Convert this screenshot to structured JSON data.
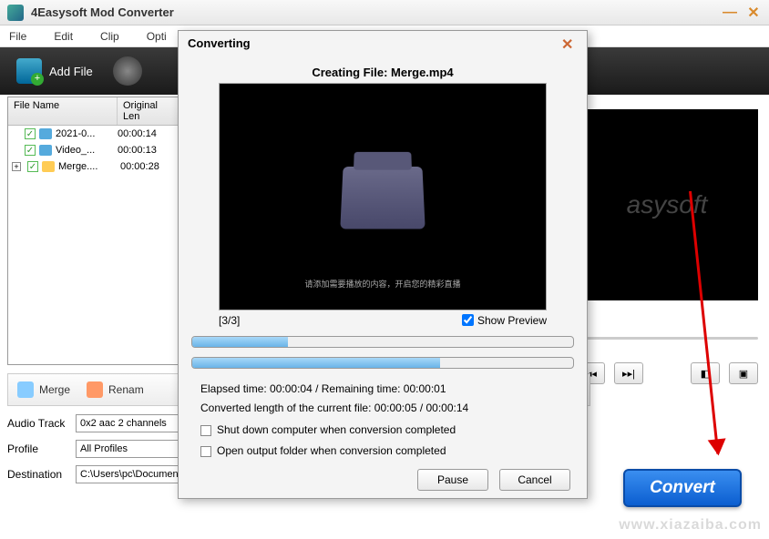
{
  "app": {
    "title": "4Easysoft Mod Converter"
  },
  "menu": {
    "file": "File",
    "edit": "Edit",
    "clip": "Clip",
    "options": "Opti"
  },
  "toolbar": {
    "addfile": "Add File"
  },
  "filelist": {
    "col_name": "File Name",
    "col_len": "Original Len",
    "rows": [
      {
        "name": "2021-0...",
        "len": "00:00:14",
        "folder": false,
        "tree": ""
      },
      {
        "name": "Video_...",
        "len": "00:00:13",
        "folder": false,
        "tree": ""
      },
      {
        "name": "Merge....",
        "len": "00:00:28",
        "folder": true,
        "tree": "+"
      }
    ]
  },
  "preview": {
    "watermark": "asysoft"
  },
  "actions": {
    "merge": "Merge",
    "rename": "Renam"
  },
  "settings": {
    "audio_label": "Audio Track",
    "audio_val": "0x2 aac 2 channels",
    "profile_label": "Profile",
    "profile_val": "All Profiles",
    "dest_label": "Destination",
    "dest_val": "C:\\Users\\pc\\Documen"
  },
  "convert": {
    "label": "Convert"
  },
  "dialog": {
    "title": "Converting",
    "creating": "Creating File: Merge.mp4",
    "preview_caption": "请添加需要播放的内容，开启您的精彩直播",
    "counter": "[3/3]",
    "showpreview": "Show Preview",
    "progress1_pct": 25,
    "progress2_pct": 65,
    "elapsed": "Elapsed time:  00:00:04 / Remaining time:  00:00:01",
    "converted": "Converted length of the current file:  00:00:05 / 00:00:14",
    "opt_shutdown": "Shut down computer when conversion completed",
    "opt_openout": "Open output folder when conversion completed",
    "pause": "Pause",
    "cancel": "Cancel"
  },
  "site_mark": "www.xiazaiba.com"
}
